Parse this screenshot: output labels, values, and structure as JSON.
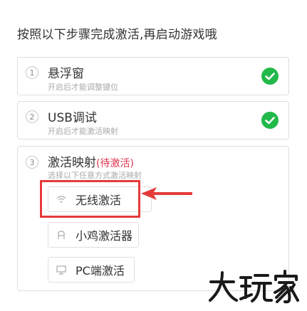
{
  "header": {
    "title": "按照以下步骤完成激活,再启动游戏哦"
  },
  "steps": [
    {
      "num": "1",
      "title": "悬浮窗",
      "subtitle": "开启后才能调整键位",
      "status": ""
    },
    {
      "num": "2",
      "title": "USB调试",
      "subtitle": "开启后才能激活映射",
      "status": ""
    },
    {
      "num": "3",
      "title": "激活映射",
      "subtitle": "选择以下任意方式激活映射",
      "status": "(待激活)"
    }
  ],
  "methods": [
    {
      "label": "无线激活",
      "icon": "wifi-icon"
    },
    {
      "label": "小鸡激活器",
      "icon": "gamepad-icon"
    },
    {
      "label": "PC端激活",
      "icon": "monitor-icon"
    }
  ],
  "watermark": {
    "text": "大玩家"
  },
  "colors": {
    "check": "#20b94a",
    "pending": "#e0344f",
    "highlight": "#e53a3a"
  }
}
